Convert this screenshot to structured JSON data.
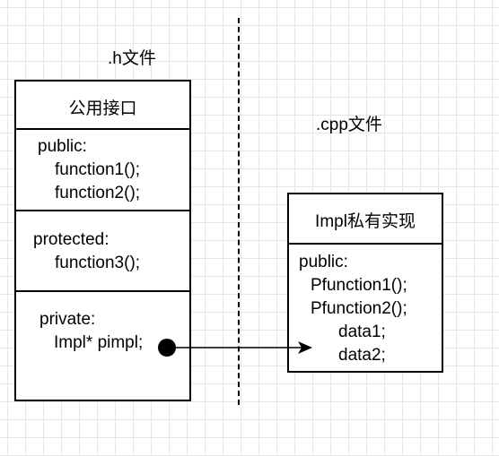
{
  "labels": {
    "h_file": ".h文件",
    "cpp_file": ".cpp文件"
  },
  "header_box": {
    "title": "公用接口",
    "public_label": "public:",
    "public_items": [
      "function1();",
      "function2();"
    ],
    "protected_label": "protected:",
    "protected_items": [
      "function3();"
    ],
    "private_label": "private:",
    "private_items": [
      "Impl* pimpl;"
    ]
  },
  "impl_box": {
    "title": "Impl私有实现",
    "public_label": "public:",
    "methods": [
      "Pfunction1();",
      "Pfunction2();"
    ],
    "members": [
      "data1;",
      "data2;"
    ]
  }
}
